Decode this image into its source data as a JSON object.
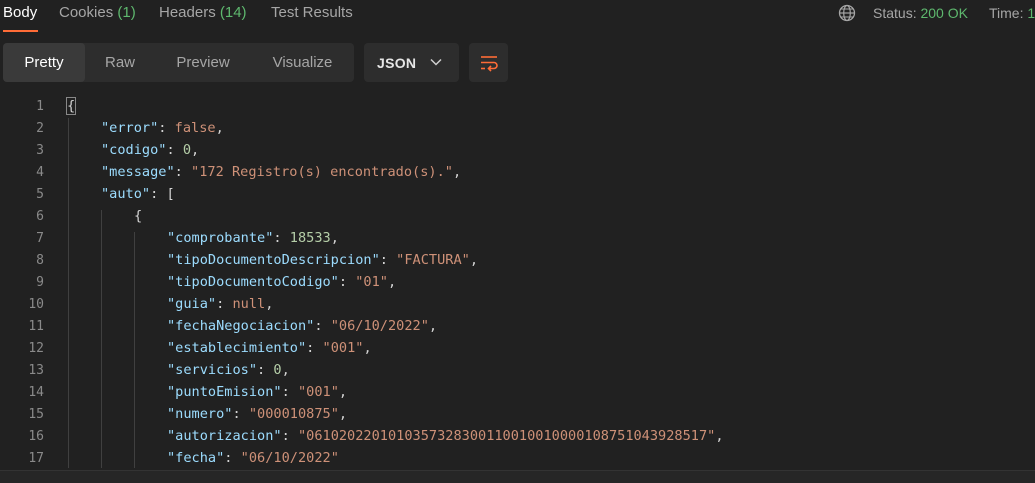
{
  "tabs": [
    {
      "label": "Body",
      "count": ""
    },
    {
      "label": "Cookies",
      "count": "(1)"
    },
    {
      "label": "Headers",
      "count": "(14)"
    },
    {
      "label": "Test Results",
      "count": ""
    }
  ],
  "status": {
    "label": "Status:",
    "value": "200 OK"
  },
  "time": {
    "label": "Time:",
    "value": "1"
  },
  "view_modes": [
    "Pretty",
    "Raw",
    "Preview",
    "Visualize"
  ],
  "format": "JSON",
  "icons": {
    "globe": "globe-icon",
    "wrap": "wrap-lines-icon",
    "dropdown": "chevron-down-icon"
  },
  "code_lines": [
    "{",
    "\"error\": false,",
    "\"codigo\": 0,",
    "\"message\": \"172 Registro(s) encontrado(s).\",",
    "\"auto\": [",
    "{",
    "\"comprobante\": 18533,",
    "\"tipoDocumentoDescripcion\": \"FACTURA\",",
    "\"tipoDocumentoCodigo\": \"01\",",
    "\"guia\": null,",
    "\"fechaNegociacion\": \"06/10/2022\",",
    "\"establecimiento\": \"001\",",
    "\"servicios\": 0,",
    "\"puntoEmision\": \"001\",",
    "\"numero\": \"000010875\",",
    "\"autorizacion\": \"0610202201010357328300110010010000108751043928517\",",
    "\"fecha\": \"06/10/2022\""
  ],
  "colors": {
    "accent": "#ff6c37",
    "status_ok": "#5eb86e",
    "key": "#9cdcfe",
    "string": "#ce9178",
    "number": "#b5cea8"
  }
}
